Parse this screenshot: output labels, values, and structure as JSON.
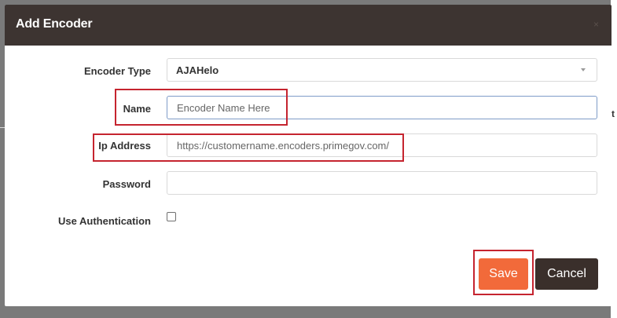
{
  "dialog": {
    "title": "Add Encoder",
    "close_label": "×"
  },
  "form": {
    "encoder_type": {
      "label": "Encoder Type",
      "value": "AJAHelo"
    },
    "name": {
      "label": "Name",
      "placeholder": "Encoder Name Here",
      "value": ""
    },
    "ip_address": {
      "label": "Ip Address",
      "placeholder": "https://customername.encoders.primegov.com/",
      "value": ""
    },
    "password": {
      "label": "Password",
      "value": ""
    },
    "use_authentication": {
      "label": "Use Authentication",
      "checked": false
    }
  },
  "actions": {
    "save_label": "Save",
    "cancel_label": "Cancel"
  },
  "colors": {
    "header_bg": "#3d3431",
    "save_button": "#f26a3a",
    "cancel_button": "#3a2f2b",
    "highlight_box": "#c5242f"
  },
  "background": {
    "partial_text": "t"
  }
}
